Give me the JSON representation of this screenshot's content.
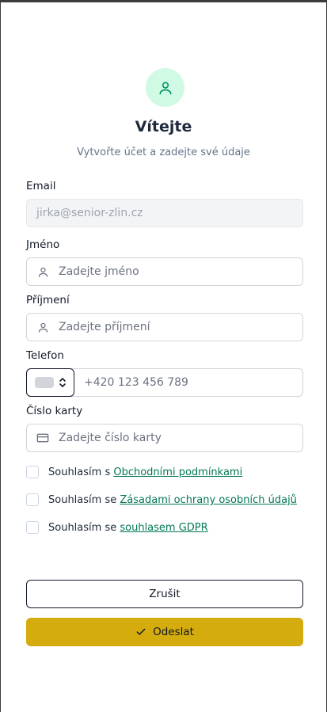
{
  "header": {
    "avatar_icon": "user-icon",
    "title": "Vítejte",
    "subtitle": "Vytvořte účet a zadejte své údaje"
  },
  "form": {
    "email": {
      "label": "Email",
      "value": "jirka@senior-zlin.cz"
    },
    "first_name": {
      "label": "Jméno",
      "placeholder": "Zadejte jméno",
      "icon": "user-icon"
    },
    "last_name": {
      "label": "Příjmení",
      "placeholder": "Zadejte příjmení",
      "icon": "user-icon"
    },
    "phone": {
      "label": "Telefon",
      "placeholder": "+420 123 456 789",
      "country_icon": "flag-icon"
    },
    "card": {
      "label": "Číslo karty",
      "placeholder": "Zadejte číslo karty",
      "icon": "credit-card-icon"
    }
  },
  "consents": [
    {
      "prefix": "Souhlasím s ",
      "link": "Obchodními podmínkami",
      "checked": false
    },
    {
      "prefix": "Souhlasím se ",
      "link": "Zásadami ochrany osobních údajů",
      "checked": false
    },
    {
      "prefix": "Souhlasím se ",
      "link": "souhlasem GDPR",
      "checked": false
    }
  ],
  "actions": {
    "cancel_label": "Zrušit",
    "submit_label": "Odeslat",
    "submit_icon": "check-icon"
  },
  "colors": {
    "accent_green": "#047857",
    "avatar_bg": "#d1fae5",
    "submit_bg": "#d4ac0d"
  }
}
